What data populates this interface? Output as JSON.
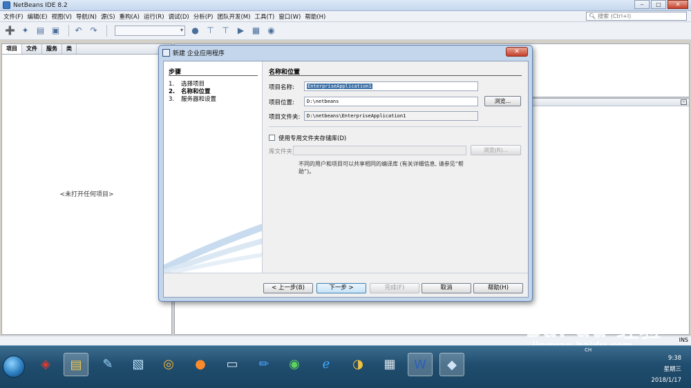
{
  "window": {
    "title": "NetBeans IDE 8.2",
    "minimize": "‒",
    "maximize": "□",
    "close": "✕"
  },
  "menu": [
    "文件(F)",
    "编辑(E)",
    "视图(V)",
    "导航(N)",
    "源(S)",
    "重构(A)",
    "运行(R)",
    "调试(D)",
    "分析(P)",
    "团队开发(M)",
    "工具(T)",
    "窗口(W)",
    "帮助(H)"
  ],
  "search": {
    "placeholder": "搜索 (Ctrl+I)"
  },
  "left_panel": {
    "tabs": [
      "项目",
      "文件",
      "服务",
      "类"
    ],
    "empty_text": "<未打开任何项目>"
  },
  "dialog": {
    "title": "新建 企业应用程序",
    "steps_title": "步骤",
    "steps": [
      {
        "num": "1.",
        "label": "选择项目"
      },
      {
        "num": "2.",
        "label": "名称和位置"
      },
      {
        "num": "3.",
        "label": "服务器和设置"
      }
    ],
    "section_title": "名称和位置",
    "project_name_label": "项目名称:",
    "project_name_value": "EnterpriseApplication1",
    "project_location_label": "项目位置:",
    "project_location_value": "D:\\netbeans",
    "browse_label": "浏览...",
    "project_folder_label": "项目文件夹:",
    "project_folder_value": "D:\\netbeans\\EnterpriseApplication1",
    "shared_lib_checkbox_label": "使用专用文件夹存储库(D)",
    "lib_folder_label": "库文件夹:",
    "lib_browse_label": "浏览(R)...",
    "note": "不同的用户和项目可以共享相同的编译库 (有关详细信息, 请参见“帮助”)。",
    "buttons": {
      "back": "< 上一步(B)",
      "next": "下一步 >",
      "finish": "完成(F)",
      "cancel": "取消",
      "help": "帮助(H)"
    }
  },
  "statusbar": {
    "ins": "INS"
  },
  "taskbar": {
    "icons": [
      "security-icon",
      "file-explorer-icon",
      "paint-icon",
      "notebook-icon",
      "search-tool-icon",
      "firefox-icon",
      "monitor-icon",
      "edit-icon",
      "green-app-icon",
      "ie-icon",
      "chrome-icon",
      "calculator-icon",
      "word-icon",
      "netbeans-icon"
    ],
    "time": "9:38",
    "weekday": "星期三",
    "date": "2018/1/17",
    "lang": "CH"
  },
  "watermark": {
    "text": "Bai du 经验",
    "sub": "jingyan.baidu.com"
  }
}
